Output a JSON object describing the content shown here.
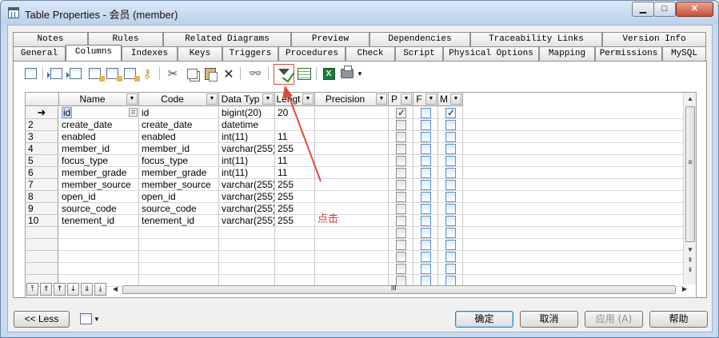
{
  "window": {
    "title": "Table Properties - 会员 (member)",
    "controls": {
      "minimize": "▁",
      "maximize": "□",
      "close": "✕"
    }
  },
  "tabs_row1": [
    "Notes",
    "Rules",
    "Related Diagrams",
    "Preview",
    "Dependencies",
    "Traceability Links",
    "Version Info"
  ],
  "tabs_row2": [
    "General",
    "Columns",
    "Indexes",
    "Keys",
    "Triggers",
    "Procedures",
    "Check",
    "Script",
    "Physical Options",
    "Mapping",
    "Permissions",
    "MySQL"
  ],
  "active_tab": "Columns",
  "toolbar_icons": [
    "properties-icon",
    "insert-row-icon",
    "add-row-icon",
    "add-columns-icon",
    "reuse-columns-icon",
    "add-domain-icon",
    "cut-icon",
    "copy-icon",
    "paste-icon",
    "delete-icon",
    "find-icon",
    "filter-icon",
    "customize-columns-icon",
    "export-excel-icon",
    "print-icon",
    "dropdown-icon"
  ],
  "grid": {
    "headers": [
      "Name",
      "Code",
      "Data Typ",
      "Lengt",
      "Precision",
      "P",
      "F",
      "M"
    ],
    "rows": [
      {
        "num": "",
        "current": true,
        "name": "id",
        "code": "id",
        "type": "bigint(20)",
        "length": "20",
        "precision": "",
        "p": true,
        "f": false,
        "m": true
      },
      {
        "num": "2",
        "name": "create_date",
        "code": "create_date",
        "type": "datetime",
        "length": "",
        "precision": "",
        "p": false,
        "f": false,
        "m": false
      },
      {
        "num": "3",
        "name": "enabled",
        "code": "enabled",
        "type": "int(11)",
        "length": "11",
        "precision": "",
        "p": false,
        "f": false,
        "m": false
      },
      {
        "num": "4",
        "name": "member_id",
        "code": "member_id",
        "type": "varchar(255)",
        "length": "255",
        "precision": "",
        "p": false,
        "f": false,
        "m": false
      },
      {
        "num": "5",
        "name": "focus_type",
        "code": "focus_type",
        "type": "int(11)",
        "length": "11",
        "precision": "",
        "p": false,
        "f": false,
        "m": false
      },
      {
        "num": "6",
        "name": "member_grade",
        "code": "member_grade",
        "type": "int(11)",
        "length": "11",
        "precision": "",
        "p": false,
        "f": false,
        "m": false
      },
      {
        "num": "7",
        "name": "member_source",
        "code": "member_source",
        "type": "varchar(255)",
        "length": "255",
        "precision": "",
        "p": false,
        "f": false,
        "m": false
      },
      {
        "num": "8",
        "name": "open_id",
        "code": "open_id",
        "type": "varchar(255)",
        "length": "255",
        "precision": "",
        "p": false,
        "f": false,
        "m": false
      },
      {
        "num": "9",
        "name": "source_code",
        "code": "source_code",
        "type": "varchar(255)",
        "length": "255",
        "precision": "",
        "p": false,
        "f": false,
        "m": false
      },
      {
        "num": "10",
        "name": "tenement_id",
        "code": "tenement_id",
        "type": "varchar(255)",
        "length": "255",
        "precision": "",
        "p": false,
        "f": false,
        "m": false
      }
    ],
    "empty_rows": 5,
    "current_row_marker": "➜",
    "name_cell_button": "="
  },
  "annotation": "点击",
  "navbar": {
    "buttons": [
      "⤒",
      "⇑",
      "↑",
      "↓",
      "⇓",
      "⤓"
    ],
    "hscroll_grip": "III"
  },
  "buttons": {
    "less": "<< Less",
    "ok": "确定",
    "cancel": "取消",
    "apply": "应用 (A)",
    "help": "帮助"
  },
  "colors": {
    "highlight": "#e04a3a",
    "annotation": "#d93a2a",
    "selection": "#cfe1fb"
  }
}
